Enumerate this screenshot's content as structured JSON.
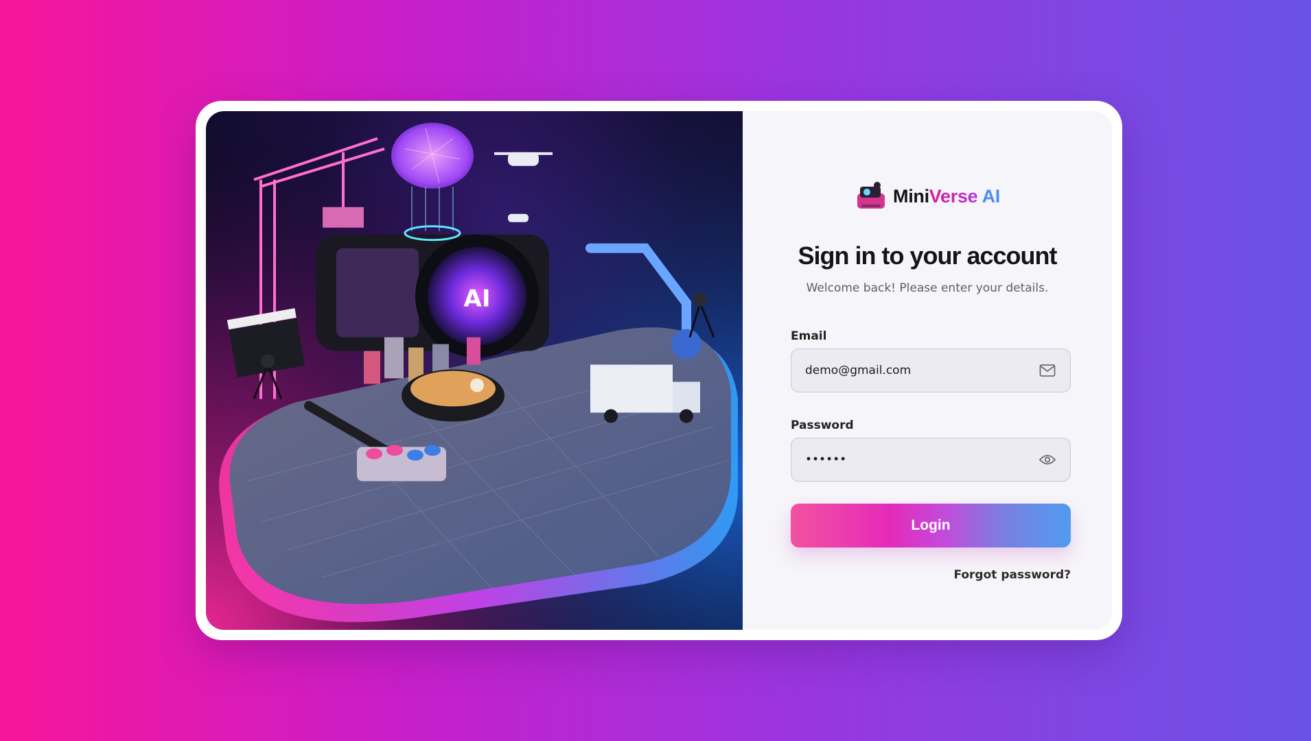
{
  "brand": {
    "part1": "Mini",
    "part2": "Verse",
    "part3": " AI"
  },
  "form": {
    "title": "Sign in to your account",
    "subtitle": "Welcome back! Please enter your details.",
    "email_label": "Email",
    "email_value": "demo@gmail.com",
    "password_label": "Password",
    "password_value": "••••••",
    "login_label": "Login",
    "forgot_label": "Forgot password?"
  },
  "hero": {
    "badge_text": "AI"
  },
  "icons": {
    "email": "mail-icon",
    "password": "eye-icon",
    "logo": "miniverse-logo-icon"
  },
  "colors": {
    "bg_start": "#f7169a",
    "bg_end": "#6a52e6",
    "button_start": "#f2529f",
    "button_end": "#4f9cf0"
  }
}
